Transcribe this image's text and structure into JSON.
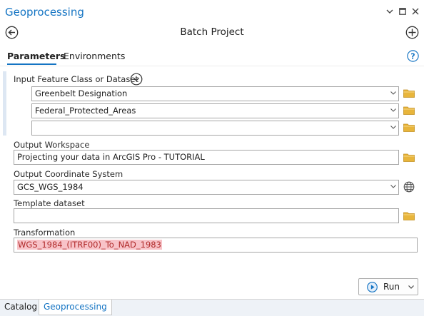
{
  "pane": {
    "title": "Geoprocessing",
    "tool_title": "Batch Project"
  },
  "tabs": [
    {
      "label": "Parameters",
      "active": true
    },
    {
      "label": "Environments",
      "active": false
    }
  ],
  "params": {
    "input_label": "Input Feature Class or Dataset",
    "input_values": [
      "Greenbelt Designation",
      "Federal_Protected_Areas",
      ""
    ],
    "output_workspace_label": "Output Workspace",
    "output_workspace_value": "Projecting your data in ArcGIS Pro - TUTORIAL",
    "coord_system_label": "Output Coordinate System",
    "coord_system_value": "GCS_WGS_1984",
    "template_label": "Template dataset",
    "template_value": "",
    "transformation_label": "Transformation",
    "transformation_value": "WGS_1984_(ITRF00)_To_NAD_1983"
  },
  "run_button": {
    "label": "Run"
  },
  "bottom_tabs": [
    {
      "label": "Catalog",
      "active": false
    },
    {
      "label": "Geoprocessing",
      "active": true
    }
  ],
  "colors": {
    "accent": "#1474c3",
    "folder": "#e8b53b",
    "highlight": "#f8c3c8"
  }
}
